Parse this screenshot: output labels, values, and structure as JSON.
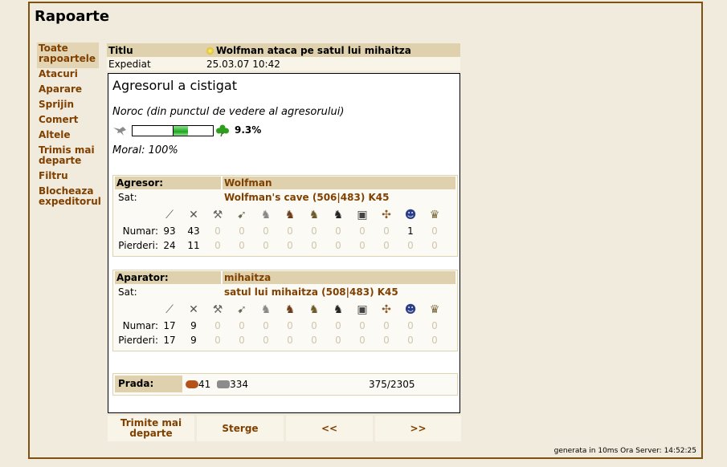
{
  "page_title": "Rapoarte",
  "menu": [
    {
      "label": "Toate rapoartele",
      "active": true
    },
    {
      "label": "Atacuri"
    },
    {
      "label": "Aparare"
    },
    {
      "label": "Sprijin"
    },
    {
      "label": "Comert"
    },
    {
      "label": "Altele"
    },
    {
      "label": "Trimis mai departe"
    },
    {
      "label": "Filtru"
    },
    {
      "label": "Blocheaza expeditorul"
    }
  ],
  "header": {
    "title_label": "Titlu",
    "title_value": "Wolfman ataca pe satul lui mihaitza",
    "sent_label": "Expediat",
    "sent_value": "25.03.07 10:42"
  },
  "report": {
    "result": "Agresorul a cistigat",
    "luck_title": "Noroc (din punctul de vedere al agresorului)",
    "luck_value": 9.3,
    "luck_text": "9.3%",
    "moral": "Moral: 100%",
    "attacker": {
      "side_label": "Agresor:",
      "player": "Wolfman",
      "village_label": "Sat:",
      "village": "Wolfman's cave (506|483) K45",
      "count_label": "Numar:",
      "loss_label": "Pierderi:",
      "counts": [
        "93",
        "43",
        "0",
        "0",
        "0",
        "0",
        "0",
        "0",
        "0",
        "0",
        "1",
        "0"
      ],
      "losses": [
        "24",
        "11",
        "0",
        "0",
        "0",
        "0",
        "0",
        "0",
        "0",
        "0",
        "0",
        "0"
      ]
    },
    "defender": {
      "side_label": "Aparator:",
      "player": "mihaitza",
      "village_label": "Sat:",
      "village": "satul lui mihaitza (508|483) K45",
      "count_label": "Numar:",
      "loss_label": "Pierderi:",
      "counts": [
        "17",
        "9",
        "0",
        "0",
        "0",
        "0",
        "0",
        "0",
        "0",
        "0",
        "0",
        "0"
      ],
      "losses": [
        "17",
        "9",
        "0",
        "0",
        "0",
        "0",
        "0",
        "0",
        "0",
        "0",
        "0",
        "0"
      ]
    },
    "unit_icons": [
      "spear-icon",
      "sword-icon",
      "axe-icon",
      "archer-icon",
      "spy-icon",
      "light-cavalry-icon",
      "mounted-archer-icon",
      "heavy-cavalry-icon",
      "ram-icon",
      "catapult-icon",
      "paladin-icon",
      "noble-icon"
    ],
    "loot": {
      "label": "Prada:",
      "wood": "41",
      "stone": "334",
      "capacity": "375/2305"
    }
  },
  "actions": [
    "Trimite mai departe",
    "Sterge",
    "<<",
    ">>"
  ],
  "footer": {
    "generated": "generata in 10ms",
    "server_time_label": "Ora Server:",
    "server_time": "14:52:25"
  }
}
